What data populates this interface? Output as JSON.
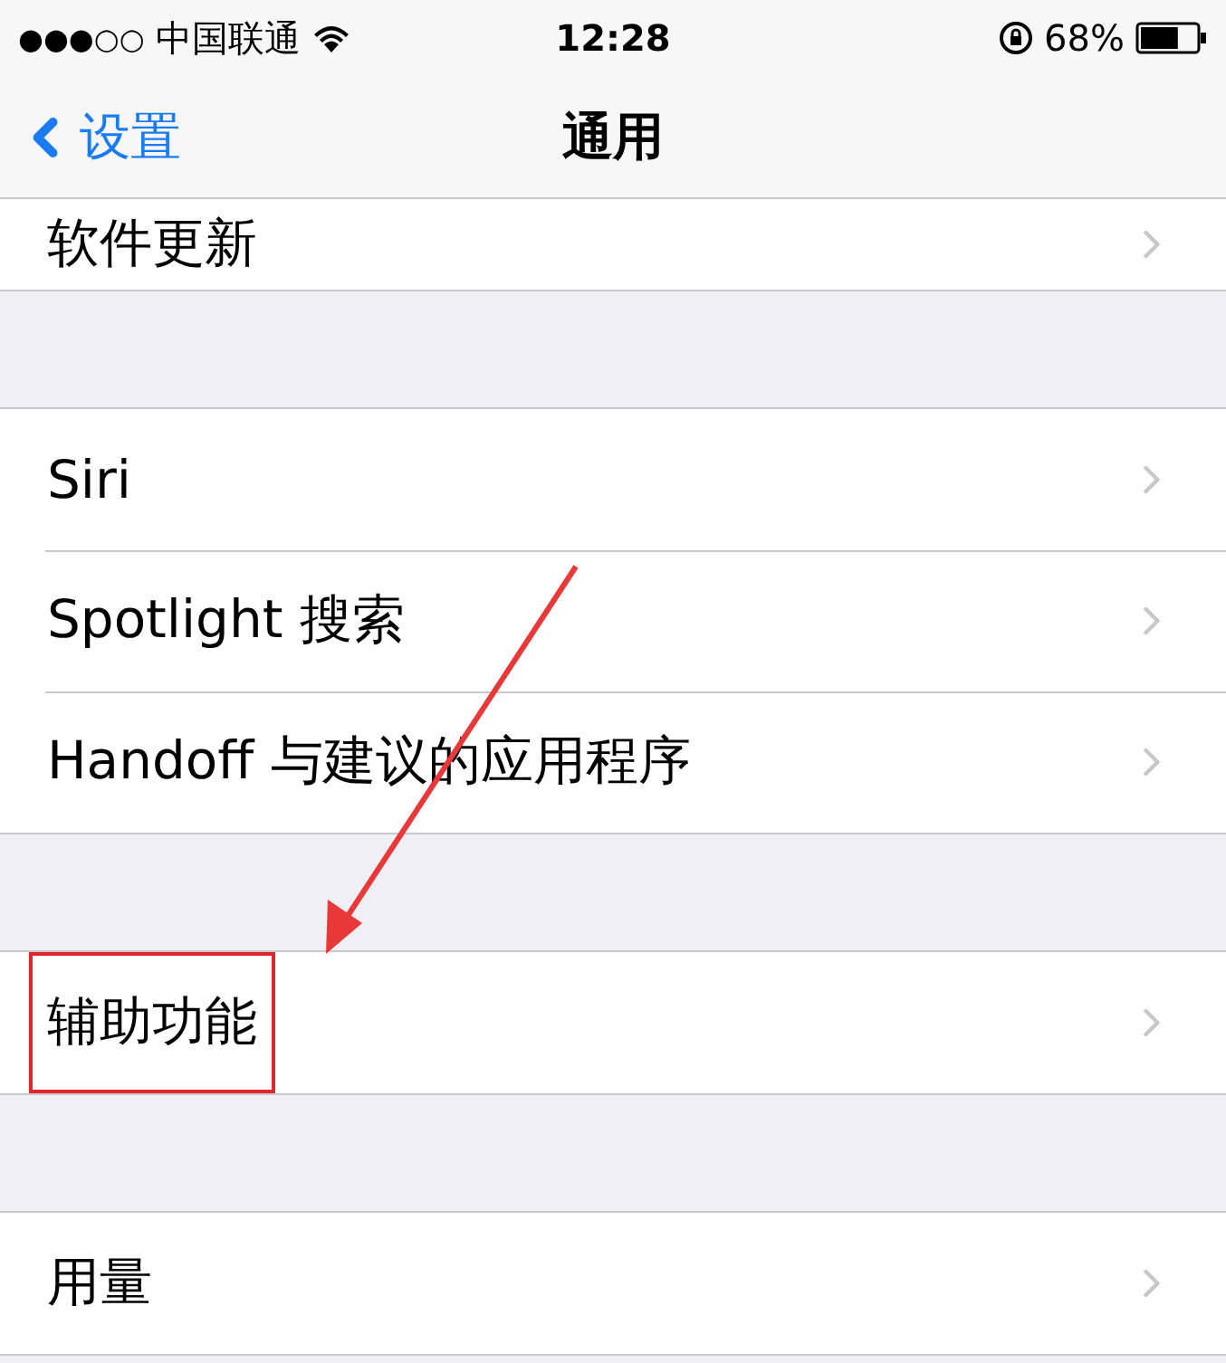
{
  "status_bar": {
    "signal": "●●●○○",
    "carrier": "中国联通",
    "time": "12:28",
    "battery": "68%",
    "level": 0.68
  },
  "nav": {
    "back": "设置",
    "title": "通用"
  },
  "groups": [
    {
      "rows": [
        {
          "label": "软件更新",
          "highlighted": false
        }
      ]
    },
    {
      "rows": [
        {
          "label": "Siri",
          "highlighted": false
        },
        {
          "label": "Spotlight 搜索",
          "highlighted": false
        },
        {
          "label": "Handoff 与建议的应用程序",
          "highlighted": false
        }
      ]
    },
    {
      "rows": [
        {
          "label": "辅助功能",
          "highlighted": true
        }
      ]
    },
    {
      "rows": [
        {
          "label": "用量",
          "highlighted": false
        }
      ]
    }
  ],
  "annotation": {
    "arrow": true
  }
}
